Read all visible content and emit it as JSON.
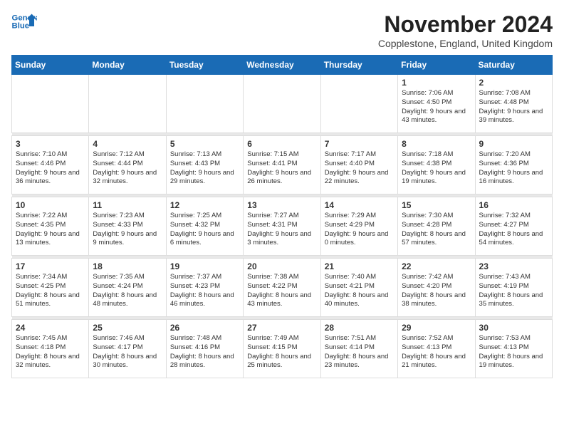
{
  "header": {
    "logo_line1": "General",
    "logo_line2": "Blue",
    "month": "November 2024",
    "location": "Copplestone, England, United Kingdom"
  },
  "weekdays": [
    "Sunday",
    "Monday",
    "Tuesday",
    "Wednesday",
    "Thursday",
    "Friday",
    "Saturday"
  ],
  "weeks": [
    [
      {
        "day": "",
        "info": ""
      },
      {
        "day": "",
        "info": ""
      },
      {
        "day": "",
        "info": ""
      },
      {
        "day": "",
        "info": ""
      },
      {
        "day": "",
        "info": ""
      },
      {
        "day": "1",
        "info": "Sunrise: 7:06 AM\nSunset: 4:50 PM\nDaylight: 9 hours and 43 minutes."
      },
      {
        "day": "2",
        "info": "Sunrise: 7:08 AM\nSunset: 4:48 PM\nDaylight: 9 hours and 39 minutes."
      }
    ],
    [
      {
        "day": "3",
        "info": "Sunrise: 7:10 AM\nSunset: 4:46 PM\nDaylight: 9 hours and 36 minutes."
      },
      {
        "day": "4",
        "info": "Sunrise: 7:12 AM\nSunset: 4:44 PM\nDaylight: 9 hours and 32 minutes."
      },
      {
        "day": "5",
        "info": "Sunrise: 7:13 AM\nSunset: 4:43 PM\nDaylight: 9 hours and 29 minutes."
      },
      {
        "day": "6",
        "info": "Sunrise: 7:15 AM\nSunset: 4:41 PM\nDaylight: 9 hours and 26 minutes."
      },
      {
        "day": "7",
        "info": "Sunrise: 7:17 AM\nSunset: 4:40 PM\nDaylight: 9 hours and 22 minutes."
      },
      {
        "day": "8",
        "info": "Sunrise: 7:18 AM\nSunset: 4:38 PM\nDaylight: 9 hours and 19 minutes."
      },
      {
        "day": "9",
        "info": "Sunrise: 7:20 AM\nSunset: 4:36 PM\nDaylight: 9 hours and 16 minutes."
      }
    ],
    [
      {
        "day": "10",
        "info": "Sunrise: 7:22 AM\nSunset: 4:35 PM\nDaylight: 9 hours and 13 minutes."
      },
      {
        "day": "11",
        "info": "Sunrise: 7:23 AM\nSunset: 4:33 PM\nDaylight: 9 hours and 9 minutes."
      },
      {
        "day": "12",
        "info": "Sunrise: 7:25 AM\nSunset: 4:32 PM\nDaylight: 9 hours and 6 minutes."
      },
      {
        "day": "13",
        "info": "Sunrise: 7:27 AM\nSunset: 4:31 PM\nDaylight: 9 hours and 3 minutes."
      },
      {
        "day": "14",
        "info": "Sunrise: 7:29 AM\nSunset: 4:29 PM\nDaylight: 9 hours and 0 minutes."
      },
      {
        "day": "15",
        "info": "Sunrise: 7:30 AM\nSunset: 4:28 PM\nDaylight: 8 hours and 57 minutes."
      },
      {
        "day": "16",
        "info": "Sunrise: 7:32 AM\nSunset: 4:27 PM\nDaylight: 8 hours and 54 minutes."
      }
    ],
    [
      {
        "day": "17",
        "info": "Sunrise: 7:34 AM\nSunset: 4:25 PM\nDaylight: 8 hours and 51 minutes."
      },
      {
        "day": "18",
        "info": "Sunrise: 7:35 AM\nSunset: 4:24 PM\nDaylight: 8 hours and 48 minutes."
      },
      {
        "day": "19",
        "info": "Sunrise: 7:37 AM\nSunset: 4:23 PM\nDaylight: 8 hours and 46 minutes."
      },
      {
        "day": "20",
        "info": "Sunrise: 7:38 AM\nSunset: 4:22 PM\nDaylight: 8 hours and 43 minutes."
      },
      {
        "day": "21",
        "info": "Sunrise: 7:40 AM\nSunset: 4:21 PM\nDaylight: 8 hours and 40 minutes."
      },
      {
        "day": "22",
        "info": "Sunrise: 7:42 AM\nSunset: 4:20 PM\nDaylight: 8 hours and 38 minutes."
      },
      {
        "day": "23",
        "info": "Sunrise: 7:43 AM\nSunset: 4:19 PM\nDaylight: 8 hours and 35 minutes."
      }
    ],
    [
      {
        "day": "24",
        "info": "Sunrise: 7:45 AM\nSunset: 4:18 PM\nDaylight: 8 hours and 32 minutes."
      },
      {
        "day": "25",
        "info": "Sunrise: 7:46 AM\nSunset: 4:17 PM\nDaylight: 8 hours and 30 minutes."
      },
      {
        "day": "26",
        "info": "Sunrise: 7:48 AM\nSunset: 4:16 PM\nDaylight: 8 hours and 28 minutes."
      },
      {
        "day": "27",
        "info": "Sunrise: 7:49 AM\nSunset: 4:15 PM\nDaylight: 8 hours and 25 minutes."
      },
      {
        "day": "28",
        "info": "Sunrise: 7:51 AM\nSunset: 4:14 PM\nDaylight: 8 hours and 23 minutes."
      },
      {
        "day": "29",
        "info": "Sunrise: 7:52 AM\nSunset: 4:13 PM\nDaylight: 8 hours and 21 minutes."
      },
      {
        "day": "30",
        "info": "Sunrise: 7:53 AM\nSunset: 4:13 PM\nDaylight: 8 hours and 19 minutes."
      }
    ]
  ]
}
